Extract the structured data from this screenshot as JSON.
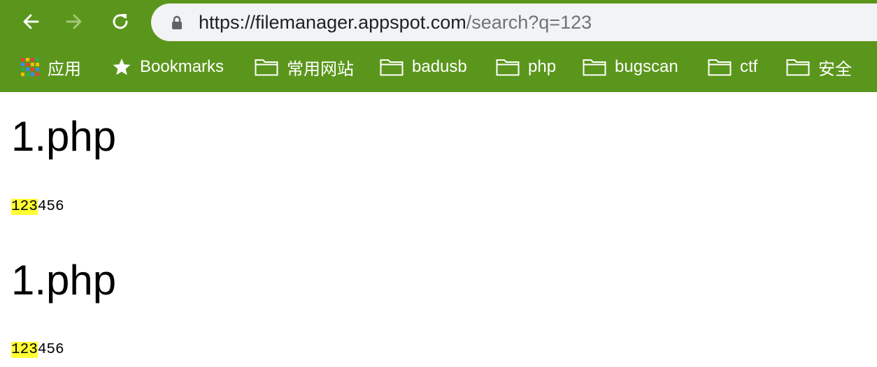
{
  "browser": {
    "url_host": "https://filemanager.appspot.com",
    "url_path": "/search?q=123",
    "theme_color": "#5b961c"
  },
  "bookmarks": [
    {
      "label": "应用",
      "icon": "apps-grid-icon"
    },
    {
      "label": "Bookmarks",
      "icon": "star-icon"
    },
    {
      "label": "常用网站",
      "icon": "folder-icon"
    },
    {
      "label": "badusb",
      "icon": "folder-icon"
    },
    {
      "label": "php",
      "icon": "folder-icon"
    },
    {
      "label": "bugscan",
      "icon": "folder-icon"
    },
    {
      "label": "ctf",
      "icon": "folder-icon"
    },
    {
      "label": "安全",
      "icon": "folder-icon"
    }
  ],
  "results": [
    {
      "title": "1.php",
      "highlight": "123",
      "rest": "456"
    },
    {
      "title": "1.php",
      "highlight": "123",
      "rest": "456"
    }
  ],
  "highlight_color": "#ffff33"
}
